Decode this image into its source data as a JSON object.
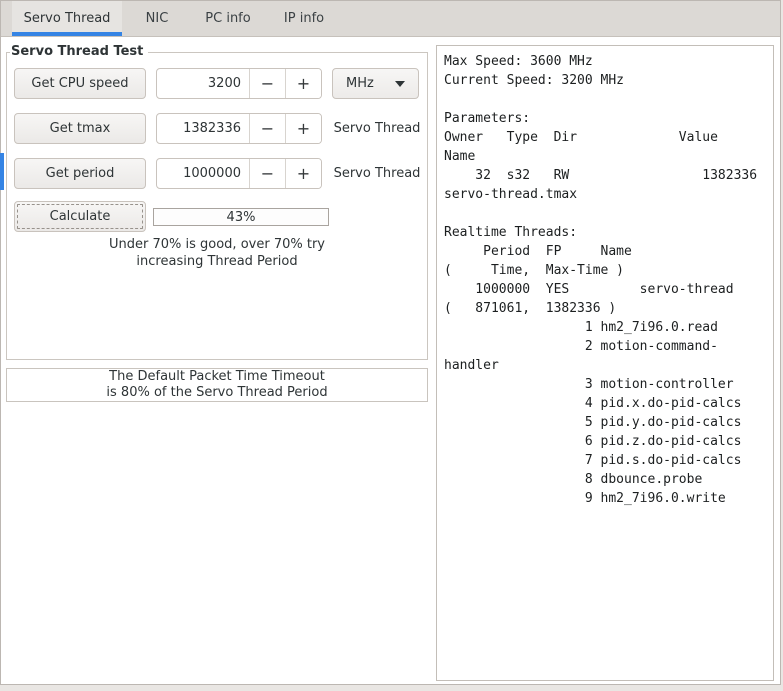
{
  "tabs": [
    {
      "label": "Servo Thread",
      "active": true
    },
    {
      "label": "NIC",
      "active": false
    },
    {
      "label": "PC info",
      "active": false
    },
    {
      "label": "IP info",
      "active": false
    }
  ],
  "frame_title": "Servo Thread Test",
  "controls": {
    "rows": [
      {
        "button": "Get CPU speed",
        "value": "3200",
        "unit": "MHz"
      },
      {
        "button": "Get tmax",
        "value": "1382336",
        "label": "Servo Thread"
      },
      {
        "button": "Get period",
        "value": "1000000",
        "label": "Servo Thread"
      }
    ],
    "minus": "−",
    "plus": "+",
    "calculate_button": "Calculate",
    "result": "43%",
    "hint_line1": "Under 70% is good, over 70% try",
    "hint_line2": "increasing Thread Period"
  },
  "timeout_note": {
    "line1": "The Default Packet Time Timeout",
    "line2": "is 80% of the Servo Thread Period"
  },
  "output_panel": {
    "lines": [
      "Max Speed: 3600 MHz",
      "Current Speed: 3200 MHz",
      "",
      "Parameters:",
      "Owner   Type  Dir             Value",
      "Name",
      "    32  s32   RW                 1382336",
      "servo-thread.tmax",
      "",
      "Realtime Threads:",
      "     Period  FP     Name",
      "(     Time,  Max-Time )",
      "    1000000  YES         servo-thread",
      "(   871061,  1382336 )",
      "                  1 hm2_7i96.0.read",
      "                  2 motion-command-",
      "handler",
      "                  3 motion-controller",
      "                  4 pid.x.do-pid-calcs",
      "                  5 pid.y.do-pid-calcs",
      "                  6 pid.z.do-pid-calcs",
      "                  7 pid.s.do-pid-calcs",
      "                  8 dbounce.probe",
      "                  9 hm2_7i96.0.write"
    ]
  },
  "colors": {
    "accent": "#3584e4",
    "header_bg": "#dcd9d5",
    "border": "#c9c4be",
    "text": "#2e3436"
  }
}
